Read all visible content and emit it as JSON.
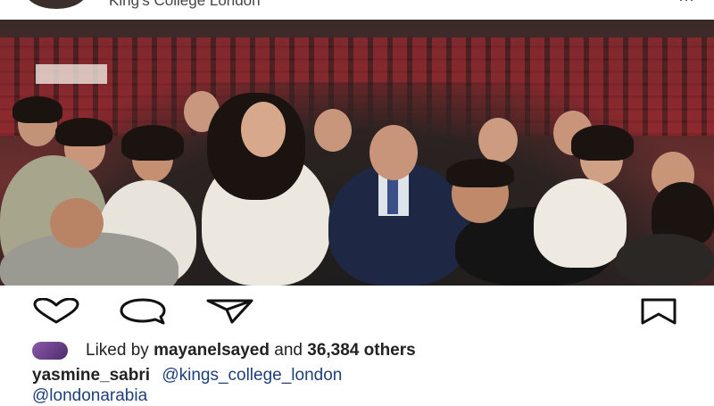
{
  "header": {
    "account_name": "King's College London",
    "menu_glyph": "⋯"
  },
  "photo": {
    "description_icon": "post-photo"
  },
  "actions": {
    "like_icon": "heart-icon",
    "comment_icon": "comment-icon",
    "share_icon": "send-icon",
    "save_icon": "bookmark-icon"
  },
  "likes": {
    "prefix": "Liked by",
    "user": "mayanelsayed",
    "joiner": "and",
    "count": "36,384 others"
  },
  "caption": {
    "username": "yasmine_sabri",
    "mention1": "@kings_college_london",
    "mention2": "@londonarabia"
  },
  "colors": {
    "mention": "#1f3f7a",
    "text": "#222222"
  }
}
